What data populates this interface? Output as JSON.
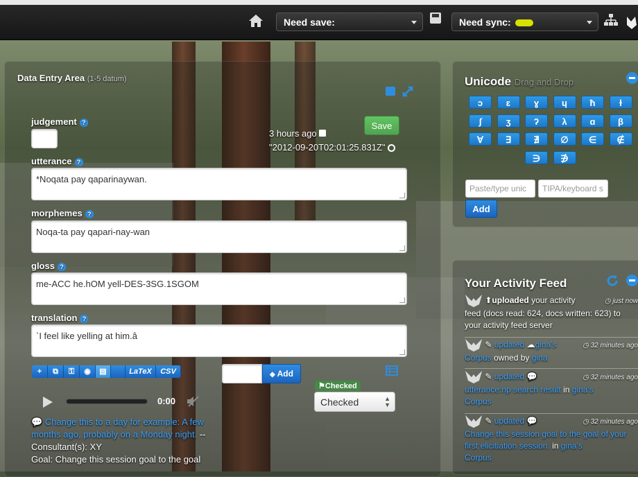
{
  "topbar": {
    "need_save_label": "Need save:",
    "need_sync_label": "Need sync:"
  },
  "data_entry": {
    "title": "Data Entry Area",
    "subtitle": "(1-5 datum)",
    "save_button": "Save",
    "timestamp_relative": "3 hours ago",
    "timestamp_iso": "\"2012-09-20T02:01:25.831Z\"",
    "fields": {
      "judgement": {
        "label": "judgement",
        "value": ""
      },
      "utterance": {
        "label": "utterance",
        "value": "*Noqata pay qaparinaywan."
      },
      "morphemes": {
        "label": "morphemes",
        "value": "Noqa-ta pay qapari-nay-wan"
      },
      "gloss": {
        "label": "gloss",
        "value": "me-ACC he.hOM yell-DES-3SG.1SGOM"
      },
      "translation": {
        "label": "translation",
        "value": "`I feel like yelling at him.â"
      }
    },
    "toolbar": {
      "latex": "LaTeX",
      "csv": "CSV"
    },
    "tag_add_button": "Add",
    "status_badge": "Checked",
    "status_select": "Checked",
    "audio_time": "0:00",
    "comment": {
      "link_text": "Change this to a day for example: A few months ago, probably on a Monday night.",
      "consultants": "-- Consultant(s): XY",
      "goal": "Goal: Change this session goal to the goal"
    }
  },
  "unicode": {
    "title": "Unicode",
    "subtitle": "Drag and Drop",
    "keys": [
      "ɔ",
      "ɛ",
      "ɣ",
      "ɥ",
      "ħ",
      "ɫ",
      "ʃ",
      "ʒ",
      "ʔ",
      "λ",
      "ɑ",
      "β",
      "∀",
      "∃",
      "∄",
      "∅",
      "∈",
      "∉",
      "∋",
      "∌"
    ],
    "paste_placeholder": "Paste/type unic",
    "tipa_placeholder": "TIPA/keyboard s",
    "add_button": "Add"
  },
  "activity_feed": {
    "title": "Your Activity Feed",
    "items": [
      {
        "action": "uploaded",
        "rest": "your activity",
        "time": "just now",
        "body": "feed (docs read: 624, docs written: 623) to your activity feed server"
      },
      {
        "action": "updated",
        "owner": "gina's",
        "target": "Corpus",
        "rest": "owned by",
        "rest_link": "gina",
        "time": "32 minutes ago"
      },
      {
        "action": "updated",
        "target": "utterance:np search result",
        "rest": "in",
        "owner": "gina's",
        "target2": "Corpus",
        "time": "32 minutes ago"
      },
      {
        "action": "updated",
        "target": "Change this session goal to the goal of your first elicitiation session.",
        "rest": "in",
        "owner": "gina's",
        "target2": "Corpus",
        "time": "32 minutes ago"
      }
    ]
  },
  "colors": {
    "accent": "#2d8ee0",
    "save_green": "#5bb75b",
    "sync_pill": "#d8e000"
  }
}
